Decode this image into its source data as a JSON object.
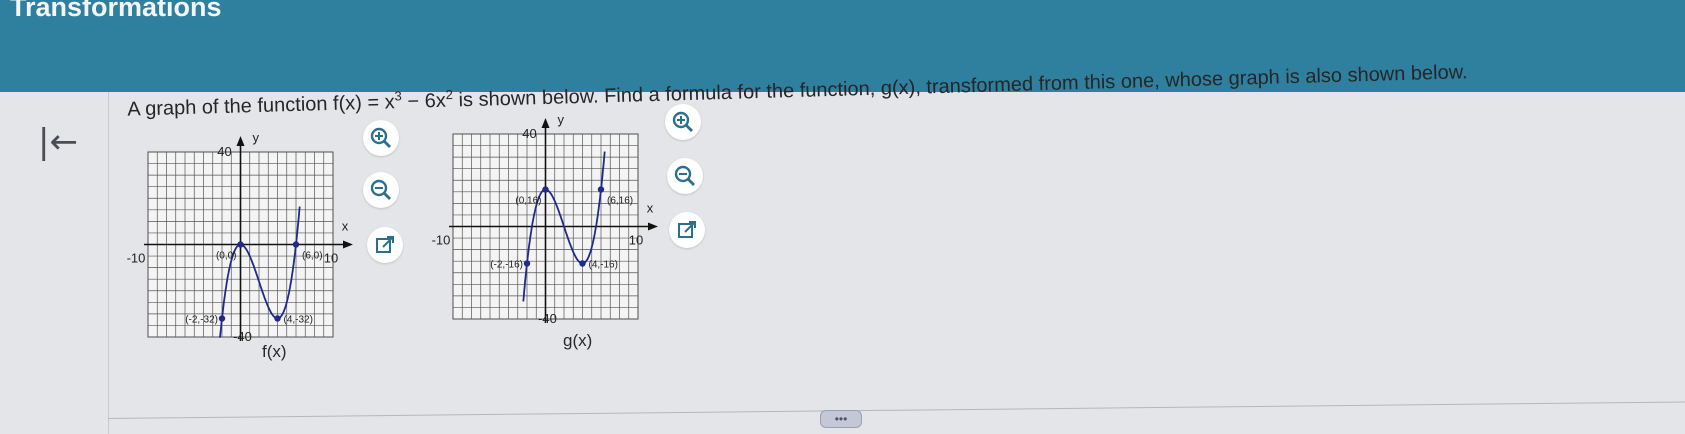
{
  "header": {
    "title": "Transformations"
  },
  "nav": {
    "back_icon": "back-to-start-icon"
  },
  "question": {
    "text_a": "A graph of the function f(x) = x",
    "exp1": "3",
    "text_b": " − 6x",
    "exp2": "2",
    "text_c": " is shown below. Find a formula for the function, g(x), transformed from this one, whose graph is also shown below."
  },
  "graphs": [
    {
      "caption": "f(x)",
      "axis_x": "x",
      "axis_y": "y",
      "tick_top": "40",
      "tick_bottom": "-40",
      "tick_left": "-10",
      "tick_right": "10",
      "points": [
        {
          "label": "(0,0)",
          "x": 0,
          "y": 0
        },
        {
          "label": "(6,0)",
          "x": 6,
          "y": 0
        },
        {
          "label": "(-2,-32)",
          "x": -2,
          "y": -32
        },
        {
          "label": "(4,-32)",
          "x": 4,
          "y": -32
        }
      ]
    },
    {
      "caption": "g(x)",
      "axis_x": "x",
      "axis_y": "y",
      "tick_top": "40",
      "tick_bottom": "-40",
      "tick_left": "-10",
      "tick_right": "10",
      "points": [
        {
          "label": "(0,16)",
          "x": 0,
          "y": 16
        },
        {
          "label": "(6,16)",
          "x": 6,
          "y": 16
        },
        {
          "label": "(-2,-16)",
          "x": -2,
          "y": -16
        },
        {
          "label": "(4,-16)",
          "x": 4,
          "y": -16
        }
      ]
    }
  ],
  "icons": {
    "zoom_in": "zoom-in-icon",
    "zoom_out": "zoom-out-icon",
    "open_external": "open-external-icon"
  },
  "more_handle": "•••",
  "colors": {
    "header": "#2f7f9e",
    "curve": "#1f2a8a",
    "point": "#1f2a8a"
  }
}
